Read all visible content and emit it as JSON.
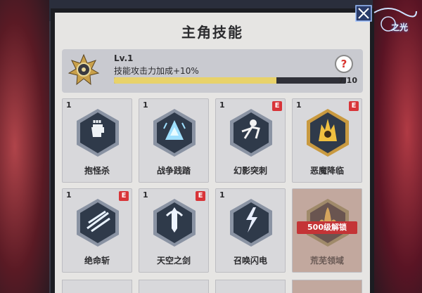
{
  "title": "主角技能",
  "level": {
    "label": "Lv.1",
    "bonus": "技能攻击力加成+10%",
    "progress_text": "7/10",
    "progress_fraction": 0.7,
    "info_icon": "question-icon"
  },
  "logo": {
    "text": "之光",
    "icon": "game-logo"
  },
  "skills": [
    {
      "level": "1",
      "name": "抱怪杀",
      "badge": "",
      "icon": "fist-icon",
      "locked": false
    },
    {
      "level": "1",
      "name": "战争践踏",
      "badge": "",
      "icon": "stomp-icon",
      "locked": false
    },
    {
      "level": "1",
      "name": "幻影突刺",
      "badge": "E",
      "icon": "phantom-icon",
      "locked": false
    },
    {
      "level": "1",
      "name": "恶魔降临",
      "badge": "E",
      "icon": "demon-icon",
      "locked": false
    },
    {
      "level": "1",
      "name": "绝命斩",
      "badge": "E",
      "icon": "slash-icon",
      "locked": false
    },
    {
      "level": "1",
      "name": "天空之剑",
      "badge": "E",
      "icon": "sword-icon",
      "locked": false
    },
    {
      "level": "1",
      "name": "召唤闪电",
      "badge": "",
      "icon": "lightning-icon",
      "locked": false
    },
    {
      "level": "",
      "name": "荒芜领域",
      "badge": "",
      "icon": "flame-icon",
      "locked": true,
      "unlock_text": "500级解锁"
    }
  ],
  "colors": {
    "panel": "#e6e5e3",
    "hex_dark": "#2f3a4a",
    "hex_rim": "#8a93a3",
    "badge_red": "#d83438",
    "progress_fill": "#e8d26a"
  }
}
